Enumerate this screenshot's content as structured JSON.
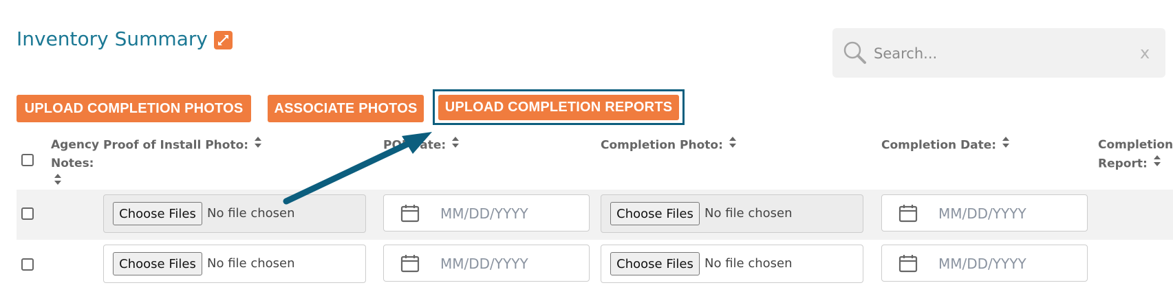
{
  "page": {
    "title": "Inventory Summary",
    "expand_icon": "expand-icon"
  },
  "search": {
    "placeholder": "Search...",
    "clear_label": "x"
  },
  "toolbar": {
    "upload_photos_label": "UPLOAD COMPLETION PHOTOS",
    "associate_photos_label": "ASSOCIATE PHOTOS",
    "upload_reports_label": "UPLOAD COMPLETION REPORTS"
  },
  "table": {
    "columns": {
      "agency_notes": "Agency Notes:",
      "proof_of_install": "Proof of Install Photo:",
      "poi_date": "POI Date:",
      "completion_photo": "Completion Photo:",
      "completion_date": "Completion Date:",
      "completion_report": "Completion Report:"
    },
    "rows": [
      {
        "choose_label": "Choose Files",
        "no_file": "No file chosen",
        "date_placeholder": "MM/DD/YYYY"
      },
      {
        "choose_label": "Choose Files",
        "no_file": "No file chosen",
        "date_placeholder": "MM/DD/YYYY"
      }
    ]
  },
  "colors": {
    "accent": "#f07c3e",
    "title": "#1b7894",
    "highlight": "#0c5e7e"
  }
}
